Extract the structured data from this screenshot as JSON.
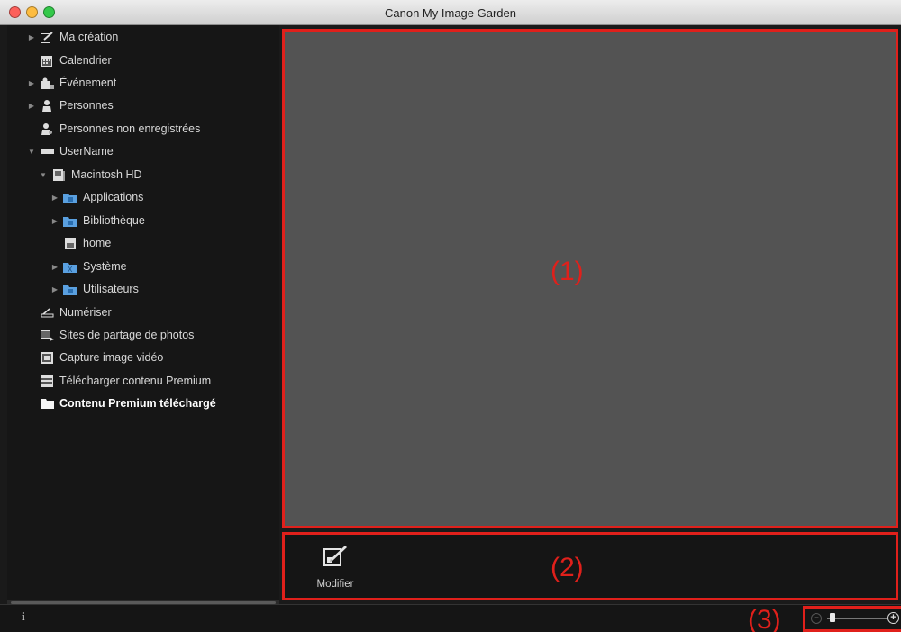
{
  "window": {
    "title": "Canon My Image Garden"
  },
  "sidebar": {
    "items": [
      {
        "label": "Ma création",
        "icon": "my-art-icon",
        "expandable": true,
        "indent": 0
      },
      {
        "label": "Calendrier",
        "icon": "calendar-icon",
        "expandable": false,
        "indent": 0
      },
      {
        "label": "Événement",
        "icon": "event-icon",
        "expandable": true,
        "indent": 0
      },
      {
        "label": "Personnes",
        "icon": "person-icon",
        "expandable": true,
        "indent": 0
      },
      {
        "label": "Personnes non enregistrées",
        "icon": "unregistered-person-icon",
        "expandable": false,
        "indent": 0
      },
      {
        "label": "UserName",
        "icon": "computer-icon",
        "expandable": true,
        "expanded": true,
        "indent": 0
      },
      {
        "label": "Macintosh HD",
        "icon": "hard-drive-icon",
        "expandable": true,
        "expanded": true,
        "indent": 1
      },
      {
        "label": "Applications",
        "icon": "folder-icon",
        "expandable": true,
        "indent": 2
      },
      {
        "label": "Bibliothèque",
        "icon": "folder-icon",
        "expandable": true,
        "indent": 2
      },
      {
        "label": "home",
        "icon": "home-folder-icon",
        "expandable": false,
        "indent": 2
      },
      {
        "label": "Système",
        "icon": "folder-icon",
        "expandable": true,
        "indent": 2
      },
      {
        "label": "Utilisateurs",
        "icon": "folder-icon",
        "expandable": true,
        "indent": 2
      },
      {
        "label": "Numériser",
        "icon": "scan-icon",
        "expandable": false,
        "indent": 0
      },
      {
        "label": "Sites de partage de photos",
        "icon": "photo-sharing-icon",
        "expandable": false,
        "indent": 0
      },
      {
        "label": "Capture image vidéo",
        "icon": "video-capture-icon",
        "expandable": false,
        "indent": 0
      },
      {
        "label": "Télécharger contenu Premium",
        "icon": "download-icon",
        "expandable": false,
        "indent": 0
      },
      {
        "label": "Contenu Premium téléchargé",
        "icon": "folder-white-icon",
        "expandable": false,
        "indent": 0,
        "selected": true
      }
    ]
  },
  "main": {
    "annotation": "(1)"
  },
  "operation": {
    "annotation": "(2)",
    "modify_label": "Modifier"
  },
  "bottom": {
    "info_label": "i",
    "annotation": "(3)",
    "zoom_minus": "−",
    "zoom_plus": "+",
    "zoom_level": 0.05
  },
  "colors": {
    "highlight_border": "#e0201b",
    "sidebar_bg": "#161616",
    "preview_bg": "#535353"
  }
}
